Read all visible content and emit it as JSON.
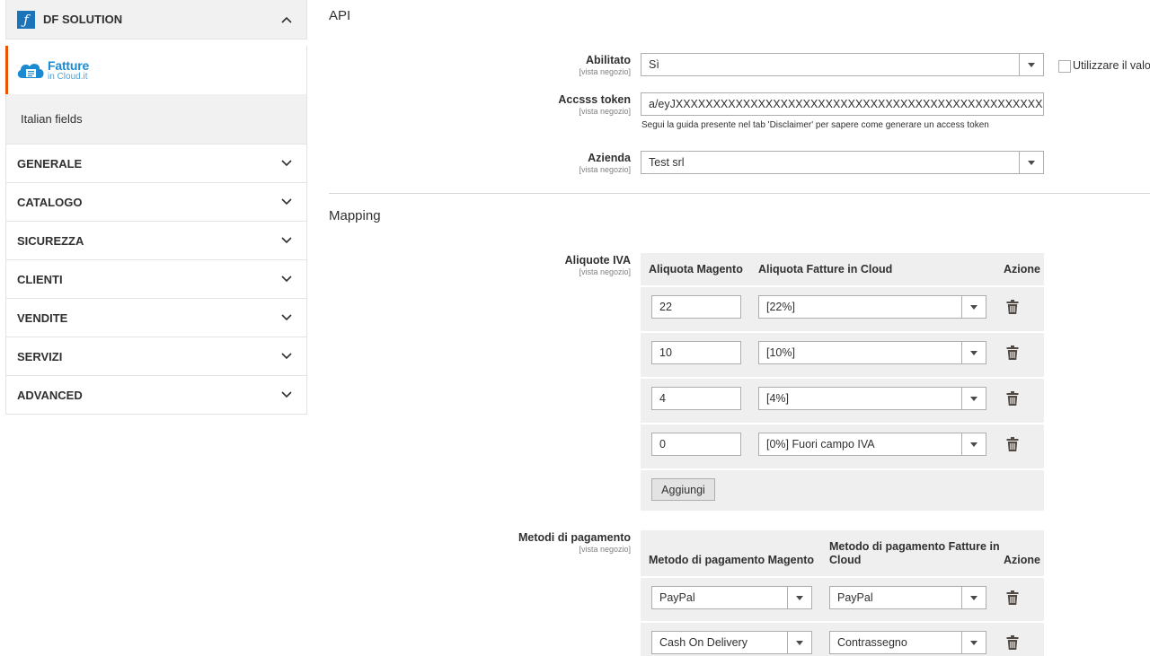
{
  "sidebar": {
    "header": "DF SOLUTION",
    "brand": {
      "main": "Fatture",
      "sub": "in Cloud.it"
    },
    "active_item": "Italian fields",
    "sections": [
      "GENERALE",
      "CATALOGO",
      "SICUREZZA",
      "CLIENTI",
      "VENDITE",
      "SERVIZI",
      "ADVANCED"
    ]
  },
  "api": {
    "title": "API",
    "enabled": {
      "label": "Abilitato",
      "scope": "[vista negozio]",
      "value": "Sì",
      "use_default": "Utilizzare il valor"
    },
    "token": {
      "label": "Accsss token",
      "scope": "[vista negozio]",
      "value": "a/eyJXXXXXXXXXXXXXXXXXXXXXXXXXXXXXXXXXXXXXXXXXXXXXXXXXXXXXXXXXXXXXXXXXXX",
      "note": "Segui la guida presente nel tab 'Disclaimer' per sapere come generare un access token"
    },
    "company": {
      "label": "Azienda",
      "scope": "[vista negozio]",
      "value": "Test srl"
    }
  },
  "mapping": {
    "title": "Mapping",
    "vat": {
      "label": "Aliquote IVA",
      "scope": "[vista negozio]",
      "col_magento": "Aliquota Magento",
      "col_cloud": "Aliquota Fatture in Cloud",
      "col_action": "Azione",
      "rows": [
        {
          "magento": "22",
          "cloud": "[22%]"
        },
        {
          "magento": "10",
          "cloud": "[10%]"
        },
        {
          "magento": "4",
          "cloud": "[4%]"
        },
        {
          "magento": "0",
          "cloud": "[0%] Fuori campo IVA"
        }
      ],
      "add_label": "Aggiungi"
    },
    "payment": {
      "label": "Metodi di pagamento",
      "scope": "[vista negozio]",
      "col_magento": "Metodo di pagamento Magento",
      "col_cloud_1": "Metodo di pagamento Fatture in",
      "col_cloud_2": "Cloud",
      "col_action": "Azione",
      "rows": [
        {
          "magento": "PayPal",
          "cloud": "PayPal"
        },
        {
          "magento": "Cash On Delivery",
          "cloud": "Contrassegno"
        }
      ]
    }
  },
  "colors": {
    "accent": "#eb5202",
    "brand_blue": "#1b8ad1",
    "panel_bg": "#efefef"
  }
}
